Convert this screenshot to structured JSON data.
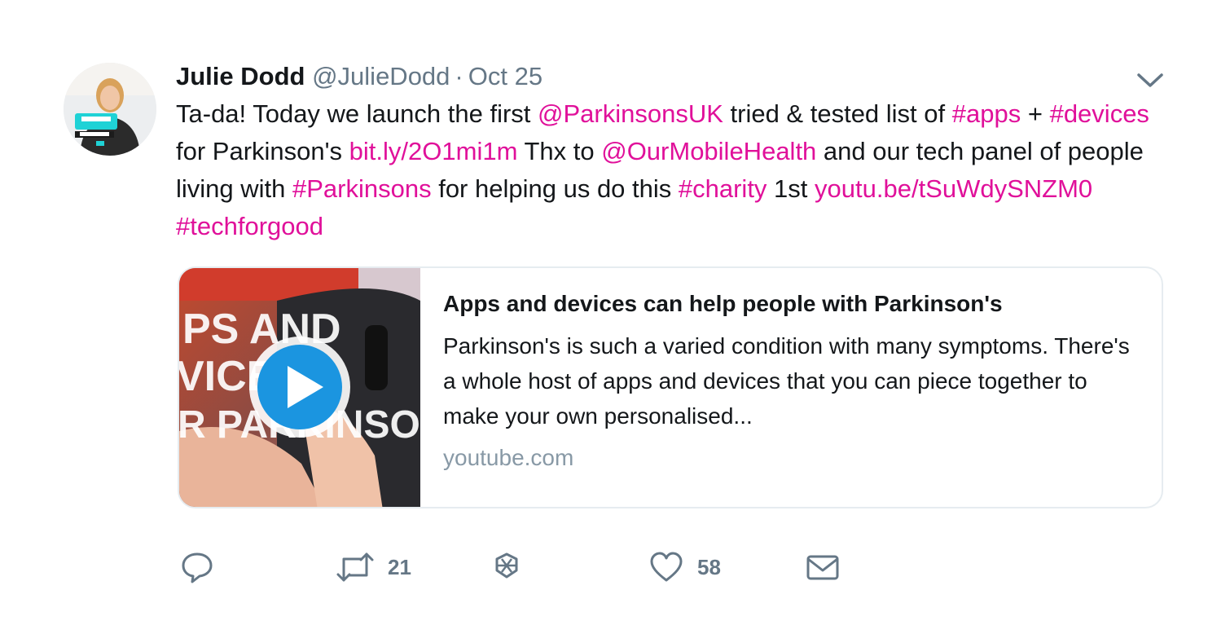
{
  "tweet": {
    "author_name": "Julie Dodd",
    "handle": "@JulieDodd",
    "separator": "·",
    "timestamp": "Oct 25",
    "text_parts": [
      {
        "t": "Ta-da! Today we launch the first ",
        "link": false
      },
      {
        "t": "@ParkinsonsUK",
        "link": true
      },
      {
        "t": " tried & tested list of ",
        "link": false
      },
      {
        "t": "#apps",
        "link": true
      },
      {
        "t": " + ",
        "link": false
      },
      {
        "t": "#devices",
        "link": true
      },
      {
        "t": " for Parkinson's ",
        "link": false
      },
      {
        "t": "bit.ly/2O1mi1m",
        "link": true
      },
      {
        "t": "  Thx to ",
        "link": false
      },
      {
        "t": "@OurMobileHealth",
        "link": true
      },
      {
        "t": " and our tech panel of people living with ",
        "link": false
      },
      {
        "t": "#Parkinsons",
        "link": true
      },
      {
        "t": " for helping us do this ",
        "link": false
      },
      {
        "t": "#charity",
        "link": true
      },
      {
        "t": " 1st ",
        "link": false
      },
      {
        "t": "youtu.be/tSuWdySNZM0",
        "link": true
      },
      {
        "t": " ",
        "link": false
      },
      {
        "t": "#techforgood",
        "link": true
      }
    ],
    "link_color": "#e0109a"
  },
  "card": {
    "title": "Apps and devices can help people with Parkinson's",
    "description": "Parkinson's is such a varied condition with many symptoms. There's a whole host of apps and devices that you can piece together to make your own personalised...",
    "domain": "youtube.com",
    "thumbnail_text": [
      "PS AND",
      "VICES",
      "R PARKINSO"
    ]
  },
  "actions": {
    "reply": {
      "icon": "reply-icon",
      "count": ""
    },
    "retweet": {
      "icon": "retweet-icon",
      "count": "21"
    },
    "moment": {
      "icon": "moment-icon",
      "count": ""
    },
    "like": {
      "icon": "heart-icon",
      "count": "58"
    },
    "message": {
      "icon": "envelope-icon",
      "count": ""
    }
  }
}
